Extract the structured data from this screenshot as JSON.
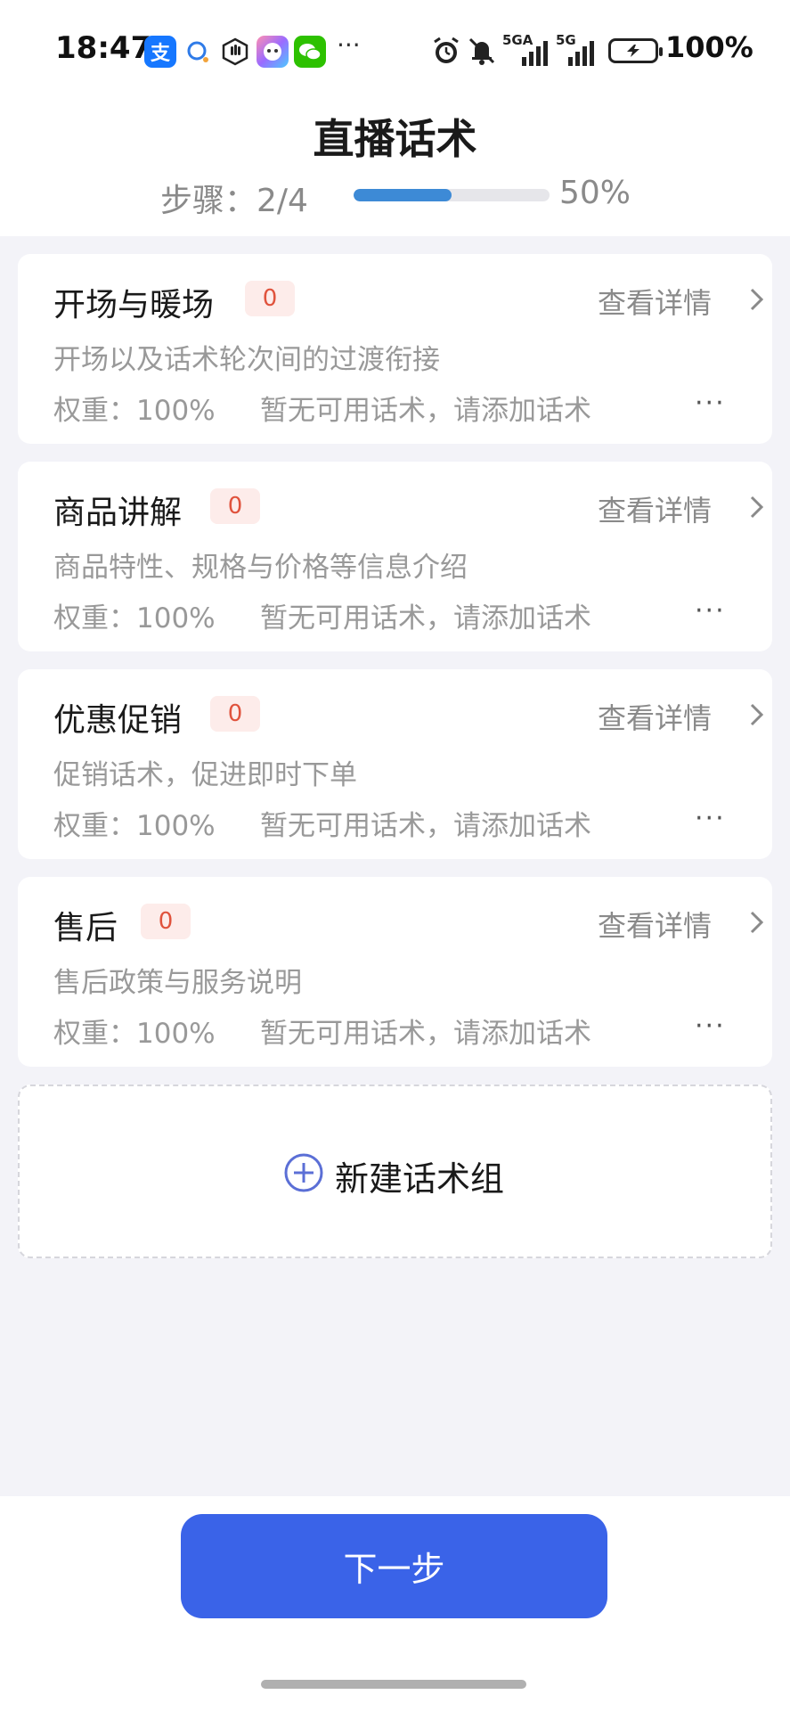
{
  "status_bar": {
    "time": "18:47",
    "app_icons": [
      {
        "name": "alipay-icon",
        "glyph": "支",
        "color": "#1677ff"
      },
      {
        "name": "chat-bubble-icon",
        "glyph": "",
        "color": "#ffffff"
      },
      {
        "name": "hand-icon",
        "glyph": "",
        "color": "#ffffff"
      },
      {
        "name": "assistant-app-icon",
        "glyph": "",
        "color": "#b45cf0"
      },
      {
        "name": "wechat-icon",
        "glyph": "",
        "color": "#2dc100"
      }
    ],
    "more_dots": "···",
    "network_1": "5GA",
    "network_2": "5G",
    "battery_percent": "100%"
  },
  "header": {
    "title": "直播话术",
    "step_label": "步骤：2/4",
    "progress_percent_label": "50%",
    "progress_value": 0.5
  },
  "groups": [
    {
      "title": "开场与暖场",
      "count": "0",
      "detail_label": "查看详情",
      "description": "开场以及话术轮次间的过渡衔接",
      "weight": "权重：100%",
      "hint": "暂无可用话术，请添加话术",
      "more": "···"
    },
    {
      "title": "商品讲解",
      "count": "0",
      "detail_label": "查看详情",
      "description": "商品特性、规格与价格等信息介绍",
      "weight": "权重：100%",
      "hint": "暂无可用话术，请添加话术",
      "more": "···"
    },
    {
      "title": "优惠促销",
      "count": "0",
      "detail_label": "查看详情",
      "description": "促销话术，促进即时下单",
      "weight": "权重：100%",
      "hint": "暂无可用话术，请添加话术",
      "more": "···"
    },
    {
      "title": "售后",
      "count": "0",
      "detail_label": "查看详情",
      "description": "售后政策与服务说明",
      "weight": "权重：100%",
      "hint": "暂无可用话术，请添加话术",
      "more": "···"
    }
  ],
  "new_group": {
    "label": "新建话术组"
  },
  "footer": {
    "next_label": "下一步"
  },
  "colors": {
    "accent": "#3a63e8",
    "progress": "#3d8ad6",
    "badge_text": "#e0533d",
    "badge_bg": "#fdecea"
  }
}
